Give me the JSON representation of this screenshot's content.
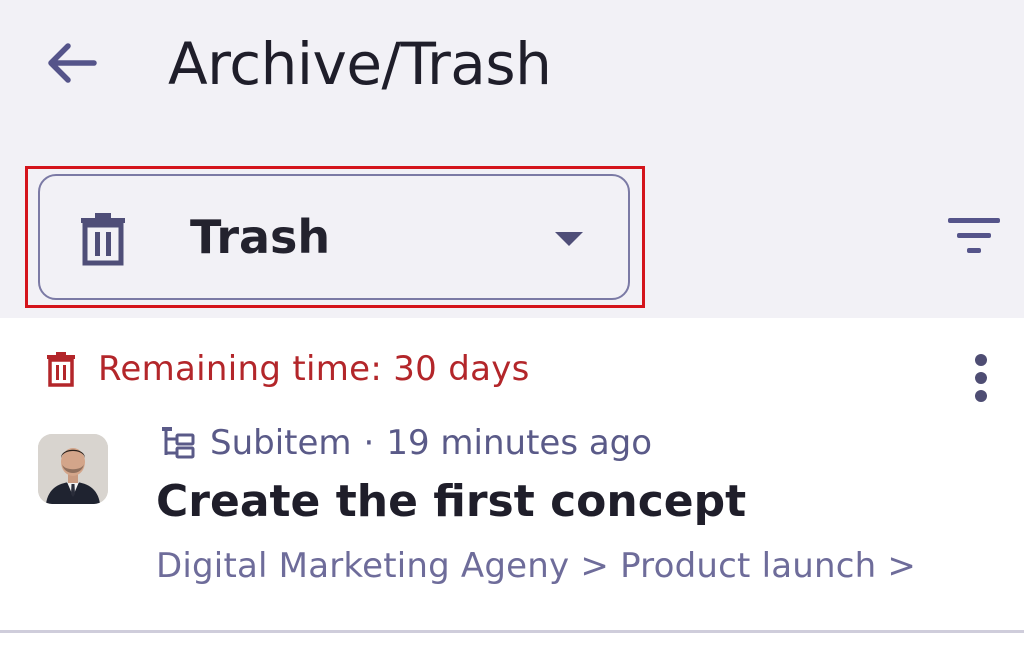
{
  "header": {
    "title": "Archive/Trash",
    "back_icon": "arrow-left-icon"
  },
  "filter_dropdown": {
    "selected_label": "Trash",
    "icon": "trash-icon"
  },
  "filter_button_icon": "filter-icon",
  "item": {
    "remaining_text": "Remaining time: 30 days",
    "type_label": "Subitem",
    "separator": "·",
    "time_ago": "19 minutes ago",
    "title": "Create the first concept",
    "breadcrumb": "Digital Marketing Ageny > Product launch >"
  },
  "colors": {
    "background": "#f2f1f6",
    "accent": "#4f4e78",
    "danger": "#b3262a",
    "highlight_border": "#d4141b",
    "card": "#ffffff"
  }
}
